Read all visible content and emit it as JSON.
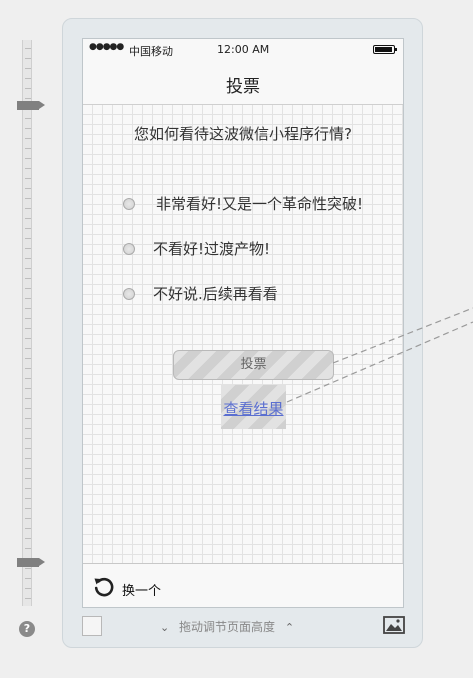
{
  "statusbar": {
    "signal": "●●●●●",
    "carrier": "中国移动",
    "time": "12:00 AM"
  },
  "nav": {
    "title": "投票"
  },
  "question": "您如何看待这波微信小程序行情?",
  "options": [
    {
      "label": "非常看好!又是一个革命性突破!"
    },
    {
      "label": "不看好!过渡产物!"
    },
    {
      "label": "不好说.后续再看看"
    }
  ],
  "vote_button": {
    "label": "投票"
  },
  "result_link": {
    "label": "查看结果"
  },
  "tabbar": {
    "item_label": "换一个",
    "icon": "refresh-icon"
  },
  "footer": {
    "drag_hint": "拖动调节页面高度",
    "help": "?"
  },
  "colors": {
    "link": "#5b6fd0",
    "frame": "#e4e9ec",
    "connector": "#9a9a9a"
  }
}
